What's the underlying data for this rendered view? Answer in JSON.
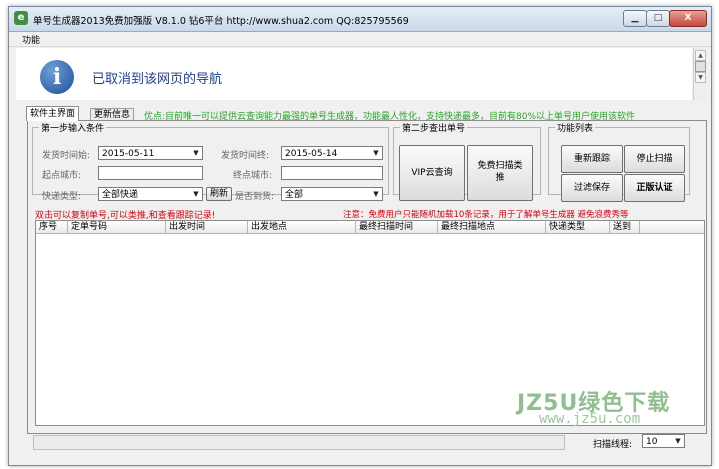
{
  "window": {
    "title": "单号生成器2013免费加强版 V8.1.0 钻6平台 http://www.shua2.com QQ:825795569",
    "app_icon": "e",
    "controls": {
      "minimize": "▁",
      "maximize": "□",
      "close": "X"
    }
  },
  "menu": {
    "items": [
      {
        "label": "功能"
      }
    ]
  },
  "info_bar": {
    "message": "已取消到该网页的导航",
    "icon_glyph": "i"
  },
  "tabs": [
    {
      "label": "软件主界面",
      "active": true
    },
    {
      "label": "更新信息",
      "active": false
    }
  ],
  "notice": "优点:目前唯一可以提供云查询能力最强的单号生成器，功能最人性化，支持快递最多，目前有80%以上单号用户使用该软件",
  "step1": {
    "legend": "第一步输入条件",
    "ship_start_label": "发货时间始:",
    "ship_start_value": "2015-05-11",
    "ship_end_label": "发货时间终:",
    "ship_end_value": "2015-05-14",
    "origin_label": "起点城市:",
    "origin_value": "",
    "dest_label": "终点城市:",
    "dest_value": "",
    "courier_label": "快递类型:",
    "courier_value": "全部快递",
    "refresh_label": "刷新",
    "arrived_label": "是否到货:",
    "arrived_value": "全部"
  },
  "step2": {
    "legend": "第二步查出单号",
    "vip_label": "VIP云查询",
    "free_scan_label": "免费扫描类推"
  },
  "function_list": {
    "legend": "功能列表",
    "retrack_label": "重新跟踪",
    "stop_scan_label": "停止扫描",
    "filter_save_label": "过滤保存",
    "auth_label": "正版认证"
  },
  "hints": {
    "left": "双击可以复制单号,可以类推,和查看跟踪记录!",
    "right": "注意：免费用户只能随机加载10条记录，用于了解单号生成器 避免浪费秀等"
  },
  "table": {
    "columns": [
      "序号",
      "定单号码",
      "出发时间",
      "出发地点",
      "最终扫描时间",
      "最终扫描地点",
      "快递类型",
      "送到"
    ],
    "rows": []
  },
  "status": {
    "thread_label": "扫描线程:",
    "thread_value": "10"
  },
  "watermark": {
    "brand": "JZ5U绿色下载",
    "url": "www.jz5u.com"
  },
  "colors": {
    "notice": "#28a428",
    "hint": "#d8000c",
    "info_text": "#1f3f9a",
    "info_icon": "#1c4f99"
  }
}
